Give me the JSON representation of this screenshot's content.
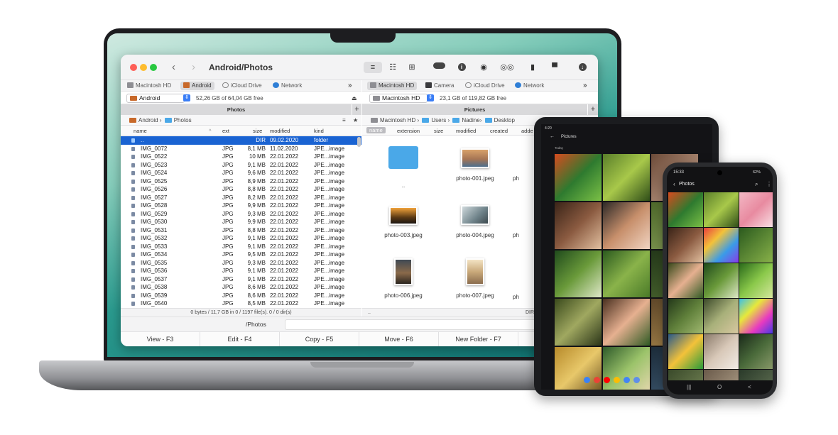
{
  "colors": {
    "selection": "#1a63d2",
    "folder": "#4aa8e8",
    "traffic_red": "#fe5f57",
    "traffic_yellow": "#febc2e",
    "traffic_green": "#28c840"
  },
  "window": {
    "title": "Android/Photos",
    "back_icon": "chevron-left-icon",
    "forward_icon": "chevron-right-icon"
  },
  "toolbar": {
    "icons": [
      "list-view-icon",
      "detail-view-icon",
      "grid-view-icon",
      "toggle-icon",
      "info-icon",
      "eye-icon",
      "binoculars-icon",
      "archive-icon",
      "terminal-icon",
      "download-icon"
    ]
  },
  "left": {
    "devices": [
      "Macintosh HD",
      "Android",
      "iCloud Drive",
      "Network"
    ],
    "more": "»",
    "drive": "Android",
    "free": "52,26 GB of 64,04 GB free",
    "eject": "⏏",
    "pane_title": "Photos",
    "crumb_root": "Android",
    "crumb_sep": "›",
    "crumb_folder": "Photos",
    "columns": {
      "name": "name",
      "ext": "ext",
      "size": "size",
      "modified": "modified",
      "kind": "kind"
    },
    "rows": [
      {
        "name": "..",
        "ext": "",
        "size": "DIR",
        "modified": "09.02.2020",
        "kind": "folder"
      },
      {
        "name": "IMG_0072",
        "ext": "JPG",
        "size": "8,1 MB",
        "modified": "11.02.2020",
        "kind": "JPE...image"
      },
      {
        "name": "IMG_0522",
        "ext": "JPG",
        "size": "10 MB",
        "modified": "22.01.2022",
        "kind": "JPE...image"
      },
      {
        "name": "IMG_0523",
        "ext": "JPG",
        "size": "9,1 MB",
        "modified": "22.01.2022",
        "kind": "JPE...image"
      },
      {
        "name": "IMG_0524",
        "ext": "JPG",
        "size": "9,6 MB",
        "modified": "22.01.2022",
        "kind": "JPE...image"
      },
      {
        "name": "IMG_0525",
        "ext": "JPG",
        "size": "8,9 MB",
        "modified": "22.01.2022",
        "kind": "JPE...image"
      },
      {
        "name": "IMG_0526",
        "ext": "JPG",
        "size": "8,8 MB",
        "modified": "22.01.2022",
        "kind": "JPE...image"
      },
      {
        "name": "IMG_0527",
        "ext": "JPG",
        "size": "8,2 MB",
        "modified": "22.01.2022",
        "kind": "JPE...image"
      },
      {
        "name": "IMG_0528",
        "ext": "JPG",
        "size": "9,9 MB",
        "modified": "22.01.2022",
        "kind": "JPE...image"
      },
      {
        "name": "IMG_0529",
        "ext": "JPG",
        "size": "9,3 MB",
        "modified": "22.01.2022",
        "kind": "JPE...image"
      },
      {
        "name": "IMG_0530",
        "ext": "JPG",
        "size": "9,9 MB",
        "modified": "22.01.2022",
        "kind": "JPE...image"
      },
      {
        "name": "IMG_0531",
        "ext": "JPG",
        "size": "8,8 MB",
        "modified": "22.01.2022",
        "kind": "JPE...image"
      },
      {
        "name": "IMG_0532",
        "ext": "JPG",
        "size": "9,1 MB",
        "modified": "22.01.2022",
        "kind": "JPE...image"
      },
      {
        "name": "IMG_0533",
        "ext": "JPG",
        "size": "9,1 MB",
        "modified": "22.01.2022",
        "kind": "JPE...image"
      },
      {
        "name": "IMG_0534",
        "ext": "JPG",
        "size": "9,5 MB",
        "modified": "22.01.2022",
        "kind": "JPE...image"
      },
      {
        "name": "IMG_0535",
        "ext": "JPG",
        "size": "9,3 MB",
        "modified": "22.01.2022",
        "kind": "JPE...image"
      },
      {
        "name": "IMG_0536",
        "ext": "JPG",
        "size": "9,1 MB",
        "modified": "22.01.2022",
        "kind": "JPE...image"
      },
      {
        "name": "IMG_0537",
        "ext": "JPG",
        "size": "9,1 MB",
        "modified": "22.01.2022",
        "kind": "JPE...image"
      },
      {
        "name": "IMG_0538",
        "ext": "JPG",
        "size": "8,6 MB",
        "modified": "22.01.2022",
        "kind": "JPE...image"
      },
      {
        "name": "IMG_0539",
        "ext": "JPG",
        "size": "8,6 MB",
        "modified": "22.01.2022",
        "kind": "JPE...image"
      },
      {
        "name": "IMG_0540",
        "ext": "JPG",
        "size": "8,5 MB",
        "modified": "22.01.2022",
        "kind": "JPE...image"
      }
    ],
    "status": "0 bytes / 11,7 GB in 0 / 1197 file(s). 0 / 0 dir(s)"
  },
  "right": {
    "devices": [
      "Macintosh HD",
      "Camera",
      "iCloud Drive",
      "Network"
    ],
    "more": "»",
    "drive": "Macintosh HD",
    "free": "23,1 GB of 119,82 GB free",
    "pane_title": "Pictures",
    "crumbs": [
      "Macintosh HD",
      "Users",
      "Nadine",
      "Desktop"
    ],
    "columns": [
      "name",
      "extension",
      "size",
      "modified",
      "created",
      "adde"
    ],
    "tiles": [
      {
        "label": ".."
      },
      {
        "label": "photo-001.jpeg"
      },
      {
        "label": "ph"
      },
      {
        "label": "photo-003.jpeg"
      },
      {
        "label": "photo-004.jpeg"
      },
      {
        "label": "ph"
      },
      {
        "label": "photo-006.jpeg"
      },
      {
        "label": "photo-007.jpeg"
      },
      {
        "label": "ph"
      }
    ],
    "status_left": "..",
    "status_right": "DIR"
  },
  "command": {
    "path": "/Photos"
  },
  "fkeys": [
    "View - F3",
    "Edit - F4",
    "Copy - F5",
    "Move - F6",
    "New Folder - F7"
  ],
  "tablet": {
    "status_time": "4:20",
    "header": "Pictures",
    "section": "Today"
  },
  "phone": {
    "status_time": "15:33",
    "status_right": "62%",
    "header": "Photos",
    "nav": [
      "|||",
      "O",
      "<"
    ]
  }
}
